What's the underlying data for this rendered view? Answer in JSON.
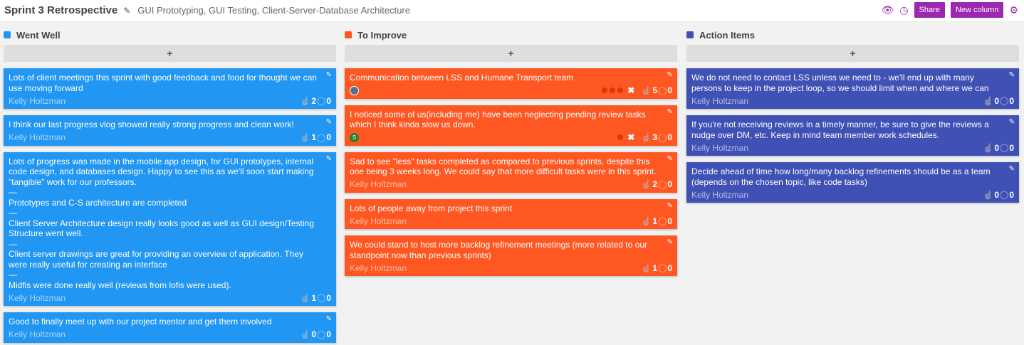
{
  "header": {
    "title": "Sprint 3 Retrospective",
    "subtitle": "GUI Prototyping, GUI Testing, Client-Server-Database Architecture",
    "share_label": "Share",
    "new_column_label": "New column"
  },
  "colors": {
    "went_well": "#2196f3",
    "to_improve": "#ff5722",
    "action_items": "#3f51b5",
    "accent": "#9c27b0"
  },
  "columns": [
    {
      "title": "Went Well",
      "add_label": "+",
      "color": "#2196f3",
      "cards": [
        {
          "text": "Lots of client meetings this sprint with good feedback and food for thought we can use moving forward",
          "author": "Kelly Holtzman",
          "likes": "2",
          "comments": "0"
        },
        {
          "text": "I think our last progress vlog showed really strong progress and clean work!",
          "author": "Kelly Holtzman",
          "likes": "1",
          "comments": "0"
        },
        {
          "text": "Lots of progress was made in the mobile app design, for GUI prototypes, internal code design, and databases design. Happy to see this as we'll soon start making \"tangible\" work for our professors.\n—\nPrototypes and C-S architecture are completed\n—\nClient Server Architecture design really looks good as well as GUI design/Testing Structure went well.\n—\nClient server drawings are great for providing an overview of application. They were really useful for creating an interface\n—\nMidfis were done really well (reviews from lofis were used).",
          "author": "Kelly Holtzman",
          "likes": "1",
          "comments": "0"
        },
        {
          "text": "Good to finally meet up with our project mentor and get them involved",
          "author": "Kelly Holtzman",
          "likes": "0",
          "comments": "0"
        }
      ]
    },
    {
      "title": "To Improve",
      "add_label": "+",
      "color": "#ff5722",
      "cards": [
        {
          "text": "Communication between LSS and Humane Transport team",
          "avatar": "",
          "votes": 3,
          "likes": "5",
          "comments": "0"
        },
        {
          "text": "I noticed some of us(including me) have been neglecting pending review tasks which I think kinda slow us down.",
          "avatar": "S",
          "votes": 1,
          "likes": "3",
          "comments": "0"
        },
        {
          "text": "Sad to see \"less\" tasks completed as compared to previous sprints, despite this one being 3 weeks long. We could say that more difficult tasks were in this sprint.",
          "author": "Kelly Holtzman",
          "likes": "2",
          "comments": "0"
        },
        {
          "text": "Lots of people away from project this sprint",
          "author": "Kelly Holtzman",
          "likes": "1",
          "comments": "0"
        },
        {
          "text": "We could stand to host more backlog refinement meetings (more related to our standpoint now than previous sprints)",
          "author": "Kelly Holtzman",
          "likes": "1",
          "comments": "0"
        }
      ]
    },
    {
      "title": "Action Items",
      "add_label": "+",
      "color": "#3f51b5",
      "cards": [
        {
          "text": "We do not need to contact LSS unless we need to - we'll end up with many persons to keep in the project loop, so we should limit when and where we can",
          "author": "Kelly Holtzman",
          "likes": "0",
          "comments": "0"
        },
        {
          "text": "If you're not receiving reviews in a timely manner, be sure to give the reviews a nudge over DM, etc. Keep in mind team member work schedules.",
          "author": "Kelly Holtzman",
          "likes": "0",
          "comments": "0"
        },
        {
          "text": "Decide ahead of time how long/many backlog refinements should be as a team (depends on the chosen topic, like code tasks)",
          "author": "Kelly Holtzman",
          "likes": "0",
          "comments": "0"
        }
      ]
    }
  ]
}
